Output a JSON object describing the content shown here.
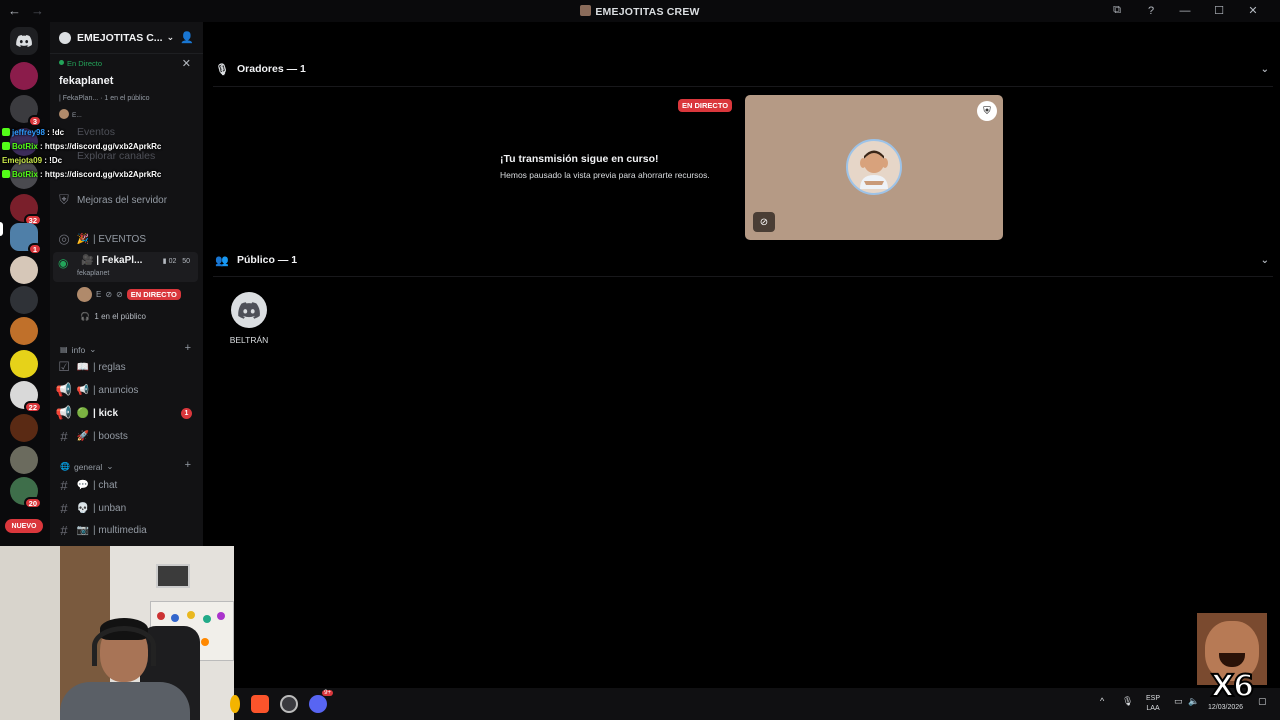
{
  "window": {
    "title": "EMEJOTITAS CREW",
    "nav_back": "←",
    "nav_forward": "→",
    "controls": [
      "⧉",
      "?",
      "—",
      "☐",
      "✕"
    ]
  },
  "rail": {
    "badges": [
      "3",
      "32",
      "1",
      "22",
      "20"
    ],
    "new_label": "NUEVO"
  },
  "sidebar": {
    "server_name": "EMEJOTITAS C...",
    "live_card": {
      "status": "En Directo",
      "streamer": "fekaplanet",
      "detail": "| FekaPlan... · 1 en el público",
      "viewer": "E..."
    },
    "ghost_items": [
      "Eventos",
      "Explorar canales"
    ],
    "server_boost": "Mejoras del servidor",
    "events_channel": "| EVENTOS",
    "stage": {
      "name": "| FekaPl...",
      "sub": "fekaplanet",
      "count_cam": "02",
      "count_users": "50",
      "user_initial": "E",
      "live_badge": "EN DIRECTO",
      "audience": "1 en el público"
    },
    "categories": [
      {
        "name": "info",
        "channels": [
          {
            "emoji": "📖",
            "name": "| reglas"
          },
          {
            "emoji": "📢",
            "name": "| anuncios"
          },
          {
            "emoji": "🟢",
            "name": "| kick",
            "unread": "1"
          },
          {
            "emoji": "🚀",
            "name": "| boosts"
          }
        ]
      },
      {
        "name": "general",
        "channels": [
          {
            "emoji": "💬",
            "name": "| chat"
          },
          {
            "emoji": "💀",
            "name": "| unban"
          },
          {
            "emoji": "📷",
            "name": "| multimedia"
          }
        ]
      }
    ]
  },
  "chat_overlay": [
    {
      "user": "jeffrey98",
      "msg": ": !dc"
    },
    {
      "user": "BotRix",
      "msg": ": https://discord.gg/vxb2AprkRc"
    },
    {
      "user": "Emejota09",
      "msg": ": !Dc"
    },
    {
      "user": "BotRix",
      "msg": ": https://discord.gg/vxb2AprkRc"
    }
  ],
  "stage_view": {
    "speakers_header": "Oradores — 1",
    "live_tag": "EN DIRECTO",
    "paused_title": "¡Tu transmisión sigue en curso!",
    "paused_sub": "Hemos pausado la vista previa para ahorrarte recursos.",
    "audience_header": "Público — 1",
    "audience_member": "BELTRÁN"
  },
  "taskbar": {
    "discord_badge": "9+",
    "lang_line1": "ESP",
    "lang_line2": "LAA",
    "date": "12/03/2026"
  },
  "meme_overlay": "X6",
  "colors": {
    "accent_red": "#da373c",
    "live_green": "#23a55a",
    "background": "#000000",
    "sidebar": "#121214"
  }
}
